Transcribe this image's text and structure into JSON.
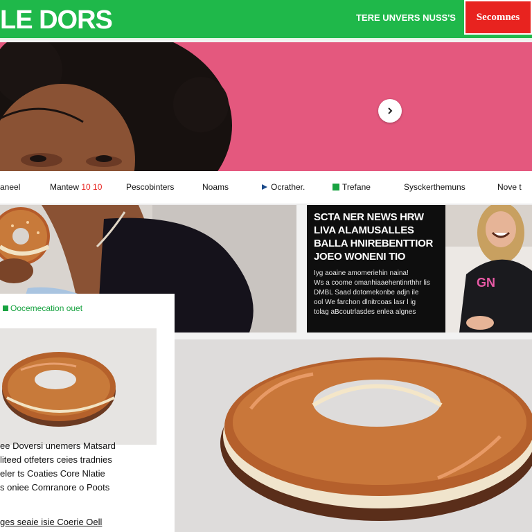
{
  "header": {
    "logo": "LE DORS",
    "tagline": "TERE UNVERS NUSS'S",
    "subscribe_label": "Secomnes"
  },
  "hero": {
    "next_icon": "chevron-right-icon"
  },
  "nav": {
    "items": [
      {
        "label": "aneel"
      },
      {
        "label": "Mantew",
        "extra": "10 10"
      },
      {
        "label": "Pescobinters"
      },
      {
        "label": "Noams"
      },
      {
        "label": "Ocrather."
      },
      {
        "label": "Trefane"
      },
      {
        "label": "Sysckerthemuns"
      },
      {
        "label": "Nove t"
      }
    ]
  },
  "news": {
    "headline_lines": [
      "SCTA NER NEWS HRW",
      "LIVA ALAMUSALLES",
      "BALLA HNIREBENTTIOR",
      "JOEO WONENI TIO"
    ],
    "body_lines": [
      "Iyg aoaine amomeriehin naina!",
      "Ws a coome omanhiaaehentinrthhr lis",
      "DMBL Saad dotomekonbe adjn ile",
      "ool We farchon dlnitrcoas lasr l ig",
      "tolag aBcoutrlasdes enlea algnes"
    ]
  },
  "side": {
    "tag": "Oocemecation ouet",
    "lines": [
      "ee Doversi unemers  Matsard",
      "liteed otfeters ceies tradnies",
      "eler ts Coaties Core Nlatie",
      "s oniee Comranore o Poots"
    ],
    "footer": "ges seaie isie Coerie Oell"
  },
  "colors": {
    "brand_green": "#1fb84a",
    "hero_pink": "#e4587e",
    "subscribe_red": "#e8231f",
    "nav_accent_red": "#e8231f"
  }
}
